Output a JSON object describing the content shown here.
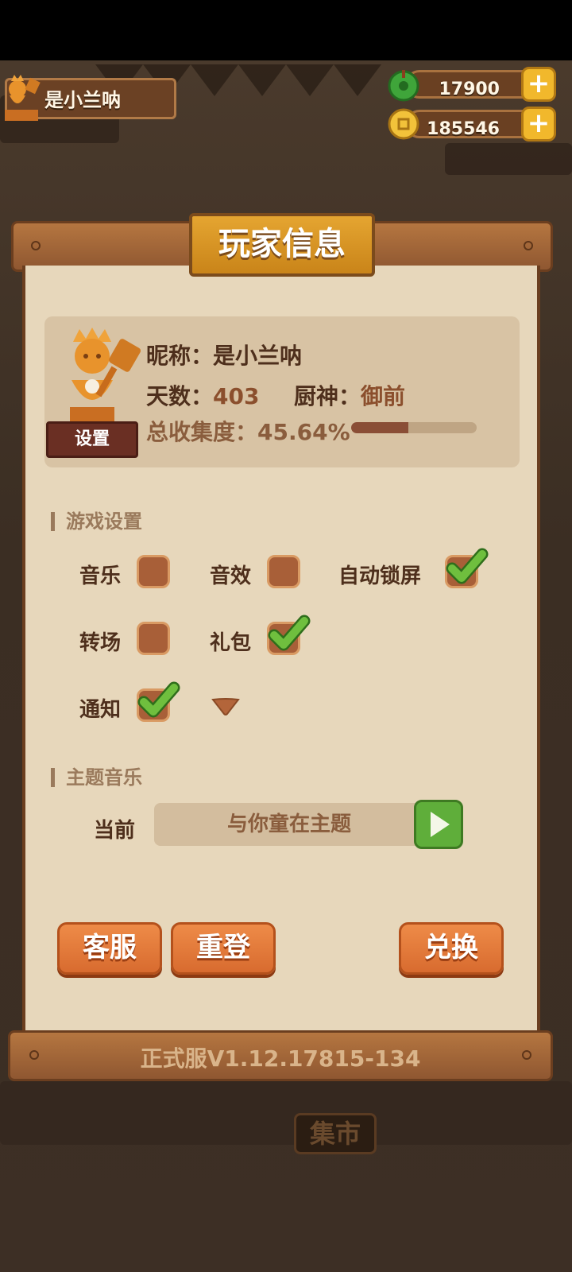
{
  "player": {
    "name": "是小兰呐"
  },
  "currencies": [
    {
      "icon": "jade-icon",
      "value": "17900",
      "plus": "+"
    },
    {
      "icon": "coin-icon",
      "value": "185546",
      "plus": "+"
    }
  ],
  "panel": {
    "title": "玩家信息",
    "profile": {
      "nickname_label": "昵称：",
      "nickname": "是小兰呐",
      "days_label": "天数：",
      "days": "403",
      "chef_label": "厨神：",
      "chef": "御前",
      "collection_label": "总收集度：",
      "collection": "45.64%",
      "collection_ratio": 0.4564,
      "settings_button": "设置"
    },
    "game_settings": {
      "heading": "游戏设置",
      "options": [
        {
          "label": "音乐",
          "checked": false
        },
        {
          "label": "音效",
          "checked": false
        },
        {
          "label": "自动锁屏",
          "checked": true
        },
        {
          "label": "转场",
          "checked": false
        },
        {
          "label": "礼包",
          "checked": true
        },
        {
          "label": "通知",
          "checked": true
        }
      ]
    },
    "theme_music": {
      "heading": "主题音乐",
      "current_label": "当前",
      "current_track": "与你童在主题"
    },
    "buttons": {
      "support": "客服",
      "relogin": "重登",
      "redeem": "兑换"
    },
    "version": "正式服V1.12.17815-134"
  },
  "background": {
    "market_sign": "集市"
  }
}
